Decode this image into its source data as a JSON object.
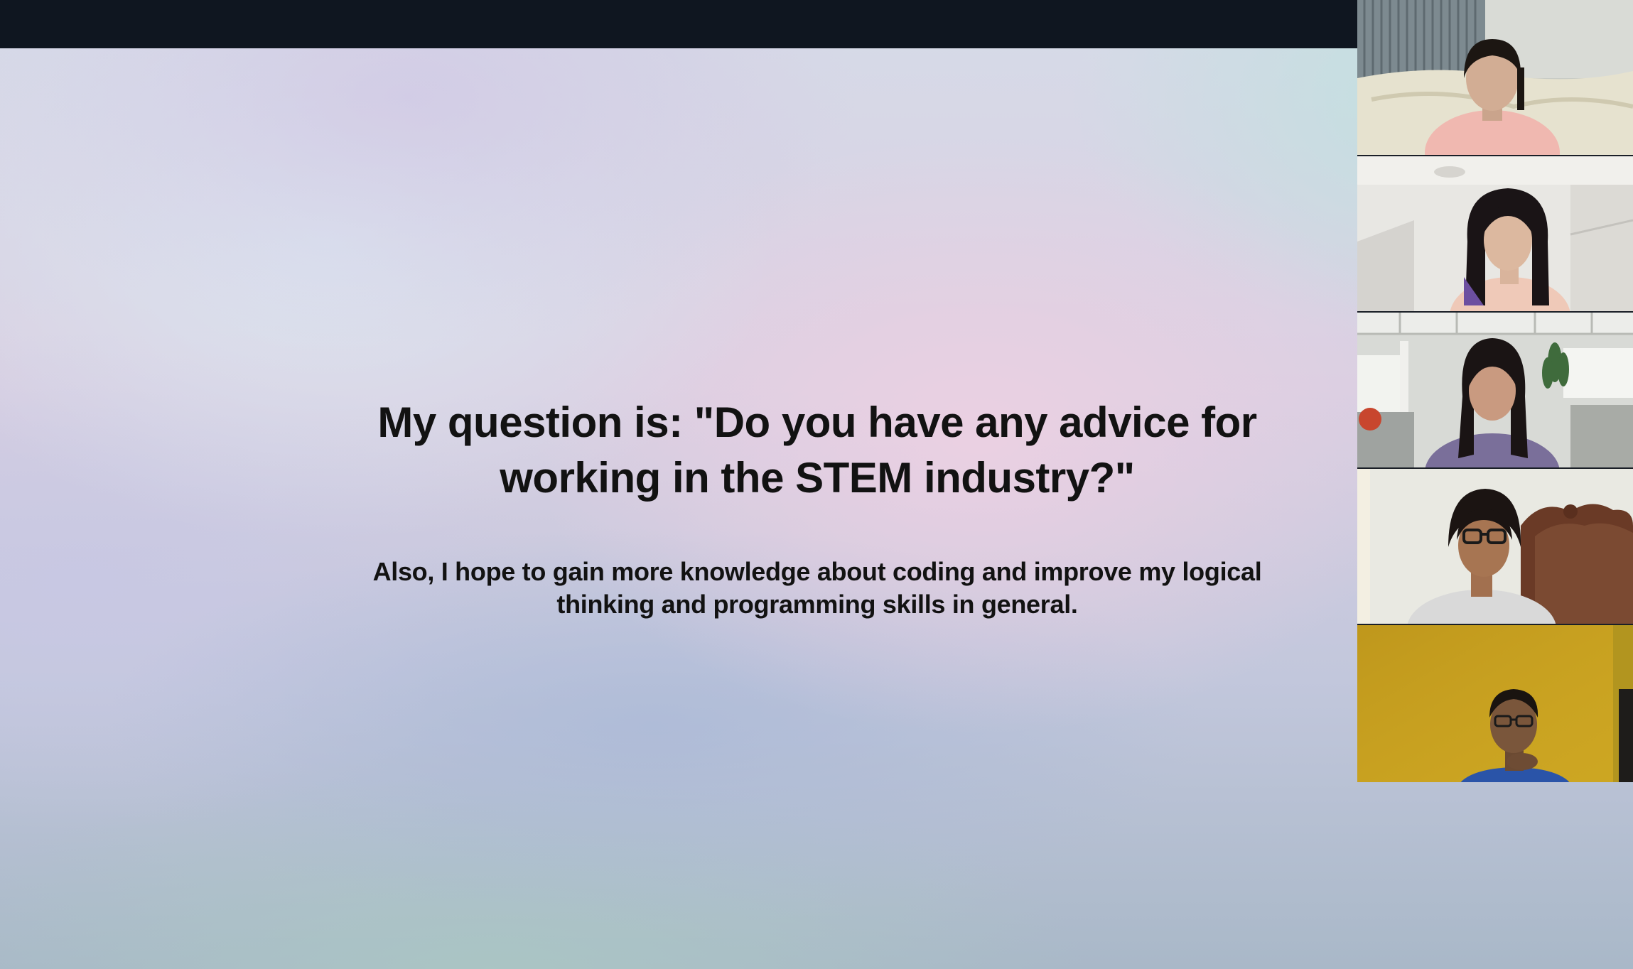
{
  "slide": {
    "question_line1": "My question is: \"Do you have any advice for",
    "question_line2": "working in the STEM industry?\"",
    "sub_line1": "Also, I hope to gain more knowledge about coding and improve my logical",
    "sub_line2": "thinking and programming skills in general."
  },
  "participants": [
    {
      "name": "",
      "background": "#cdd0cb",
      "shirt": "#f0b8b0",
      "hair": "#1c1612"
    },
    {
      "name": "",
      "background": "#e6e4e0",
      "shirt": "#efc9b8",
      "hair": "#1a1416"
    },
    {
      "name": "",
      "background": "#d8dad6",
      "shirt": "#7a6f9a",
      "hair": "#1a1414"
    },
    {
      "name": "",
      "background": "#e9e9e2",
      "shirt": "#d9d9d9",
      "hair": "#1b1412"
    },
    {
      "name": "",
      "background": "#c9a21f",
      "shirt": "#2a54a8",
      "hair": "#1a1410"
    }
  ],
  "colors": {
    "top_bar": "#0f1620",
    "text": "#121212"
  }
}
